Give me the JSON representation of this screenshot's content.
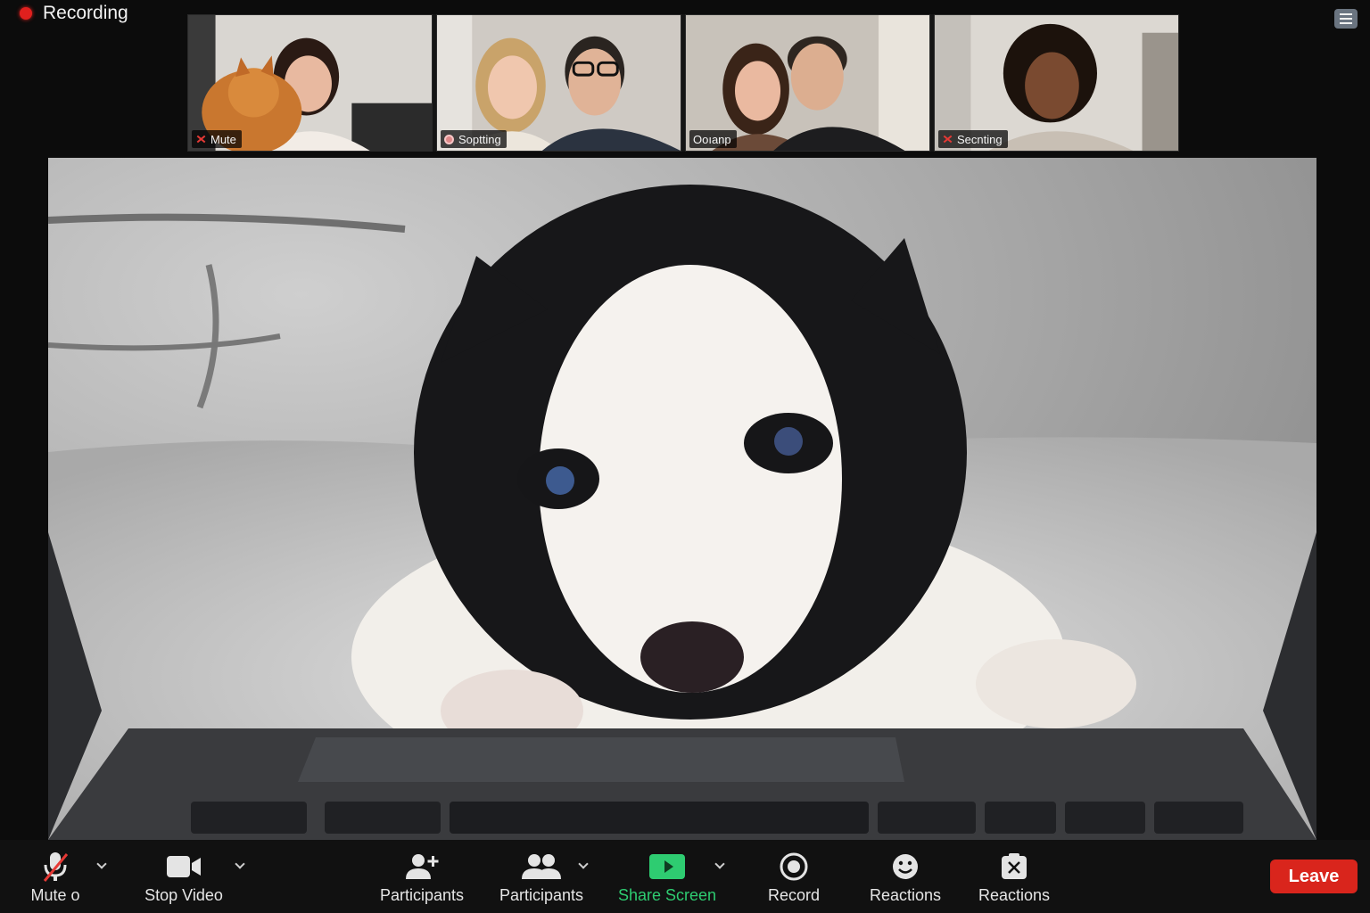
{
  "recording": {
    "label": "Recording",
    "color": "#e0201e"
  },
  "thumbnails": [
    {
      "label": "Mute",
      "status_icon": "mic-off-icon"
    },
    {
      "label": "Soptting",
      "status_icon": "speaking-icon"
    },
    {
      "label": "Ooıanp",
      "status_icon": ""
    },
    {
      "label": "Secnting",
      "status_icon": "mic-off-icon"
    }
  ],
  "toolbar": {
    "mute_label": "Mute o",
    "stop_video_label": "Stop Video",
    "participants_add_label": "Participants",
    "participants_label": "Participants",
    "share_screen_label": "Share Screen",
    "record_label": "Record",
    "reactions_label": "Reactions",
    "reactions2_label": "Reactions",
    "leave_label": "Leave"
  },
  "colors": {
    "share_green": "#2ecc71",
    "leave_red": "#d9251c",
    "background": "#0c0c0c"
  }
}
